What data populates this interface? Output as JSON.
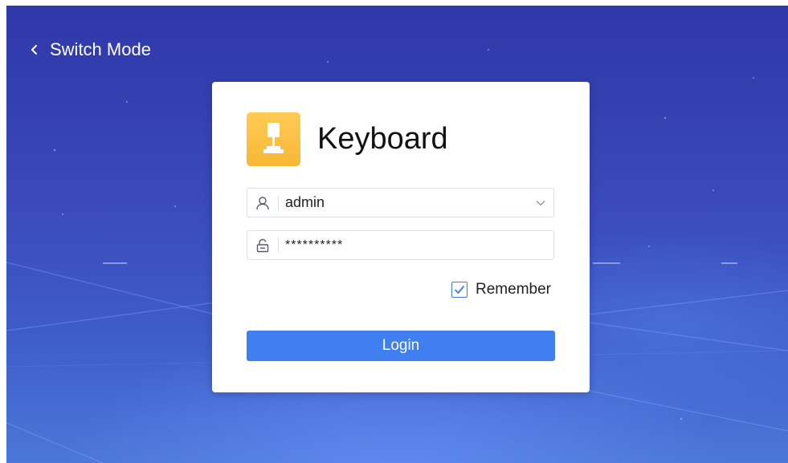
{
  "nav": {
    "back_label": "Switch Mode",
    "back_icon": "chevron-left-icon"
  },
  "login": {
    "logo_icon": "keyboard-tool-icon",
    "title": "Keyboard",
    "username": {
      "value": "admin",
      "icon": "user-icon",
      "dropdown_icon": "chevron-down-icon"
    },
    "password": {
      "value": "**********",
      "icon": "lock-icon"
    },
    "remember": {
      "label": "Remember",
      "checked": true
    },
    "submit_label": "Login"
  },
  "colors": {
    "background": "#3a48b8",
    "primary": "#3f7fef",
    "logo": "#f7b733",
    "card": "#ffffff"
  }
}
